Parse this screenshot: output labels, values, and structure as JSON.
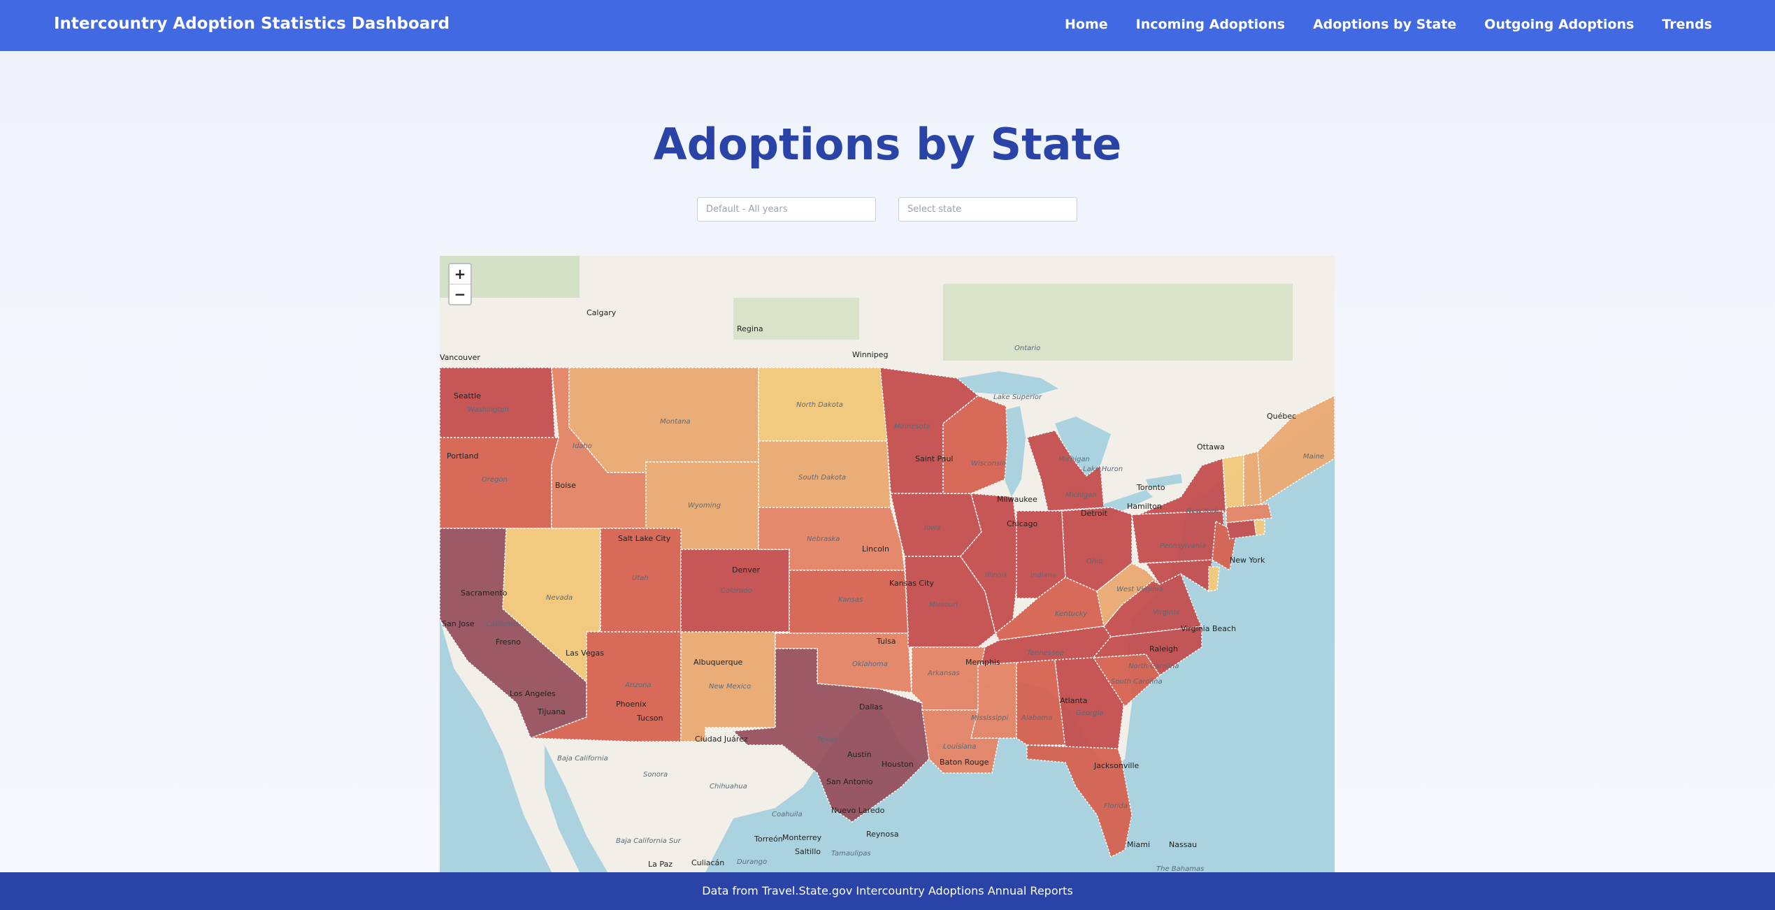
{
  "header": {
    "title": "Intercountry Adoption Statistics Dashboard",
    "nav": [
      "Home",
      "Incoming Adoptions",
      "Adoptions by State",
      "Outgoing Adoptions",
      "Trends"
    ]
  },
  "main": {
    "title": "Adoptions by State",
    "year_select": {
      "placeholder": "Default - All years"
    },
    "state_select": {
      "placeholder": "Select state"
    }
  },
  "map": {
    "zoom_in": "+",
    "zoom_out": "−",
    "colors": {
      "water": "#aad3df",
      "land": "#f2efe9",
      "forest": "#c8dbb6",
      "lowest": "#f3c97a",
      "low": "#ebaa73",
      "mid": "#e58466",
      "high": "#d66352",
      "higher": "#c44f4f",
      "highest": "#98515f"
    },
    "cities": [
      "Calgary",
      "Regina",
      "Winnipeg",
      "Vancouver",
      "Ottawa",
      "Québec",
      "Toronto",
      "Hamilton",
      "Seattle",
      "Portland",
      "Boise",
      "Sacramento",
      "San Jose",
      "Fresno",
      "Los Angeles",
      "Tijuana",
      "Las Vegas",
      "Salt Lake City",
      "Denver",
      "Phoenix",
      "Tucson",
      "Albuquerque",
      "Ciudad Juárez",
      "Lincoln",
      "Kansas City",
      "Tulsa",
      "Dallas",
      "Austin",
      "San Antonio",
      "Houston",
      "Nuevo Laredo",
      "Reynosa",
      "Monterrey",
      "Saltillo",
      "Torreón",
      "Culiacán",
      "La Paz",
      "Saint Paul",
      "Milwaukee",
      "Chicago",
      "Detroit",
      "Memphis",
      "Atlanta",
      "Jacksonville",
      "Miami",
      "Nassau",
      "Raleigh",
      "Virginia Beach",
      "New York",
      "Baton Rouge"
    ],
    "regions": [
      "Washington",
      "Oregon",
      "Idaho",
      "Montana",
      "North Dakota",
      "South Dakota",
      "Wyoming",
      "Nevada",
      "Utah",
      "Colorado",
      "California",
      "Arizona",
      "New Mexico",
      "Nebraska",
      "Kansas",
      "Oklahoma",
      "Texas",
      "Minnesota",
      "Iowa",
      "Missouri",
      "Arkansas",
      "Louisiana",
      "Wisconsin",
      "Illinois",
      "Michigan",
      "Indiana",
      "Ohio",
      "Kentucky",
      "Tennessee",
      "Mississippi",
      "Alabama",
      "Georgia",
      "Florida",
      "South Carolina",
      "North Carolina",
      "Virginia",
      "West Virginia",
      "Pennsylvania",
      "New York",
      "Maine",
      "Ontario",
      "Baja California",
      "Baja California Sur",
      "Sonora",
      "Chihuahua",
      "Coahuila",
      "Durango",
      "Tamaulipas",
      "The Bahamas",
      "Lake Huron",
      "Lake Superior",
      "Michigan"
    ]
  },
  "footer": {
    "text": "Data from Travel.State.gov Intercountry Adoptions Annual Reports"
  }
}
